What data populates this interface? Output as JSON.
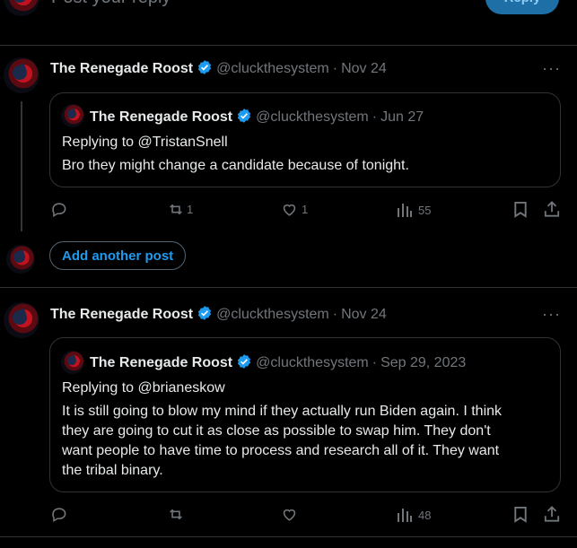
{
  "composer": {
    "placeholder": "Post your reply",
    "reply_label": "Reply"
  },
  "posts": [
    {
      "author": "The Renegade Roost",
      "handle": "@cluckthesystem",
      "separator": "·",
      "date": "Nov 24",
      "quote": {
        "author": "The Renegade Roost",
        "handle": "@cluckthesystem",
        "separator": "·",
        "date": "Jun 27",
        "replying_to_prefix": "Replying to ",
        "replying_to_user": "@TristanSnell",
        "text": "Bro they might change a candidate because of tonight."
      },
      "actions": {
        "reposts": "1",
        "likes": "1",
        "views": "55"
      }
    },
    {
      "author": "The Renegade Roost",
      "handle": "@cluckthesystem",
      "separator": "·",
      "date": "Nov 24",
      "quote": {
        "author": "The Renegade Roost",
        "handle": "@cluckthesystem",
        "separator": "·",
        "date": "Sep 29, 2023",
        "replying_to_prefix": "Replying to ",
        "replying_to_user": "@brianeskow",
        "text_lines": [
          "It is still going to blow my mind if they actually run Biden again. I think",
          "they are going to cut it as close as possible to swap him. They don't",
          "want people to have time to process and research all of it. They want",
          "the tribal binary."
        ]
      },
      "actions": {
        "reposts": "",
        "likes": "",
        "views": "48"
      }
    }
  ],
  "thread": {
    "add_another_post": "Add another post"
  },
  "colors": {
    "accent": "#1d9bf0",
    "verified": "#1d9bf0",
    "muted": "#71767b",
    "border": "#2f3336"
  }
}
